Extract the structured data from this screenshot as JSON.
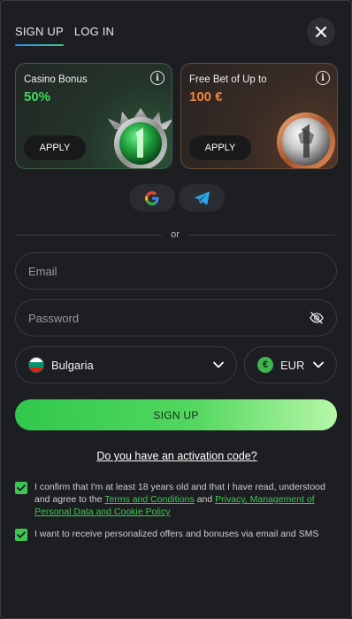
{
  "tabs": [
    {
      "label": "SIGN UP",
      "active": true
    },
    {
      "label": "LOG IN",
      "active": false
    }
  ],
  "cards": [
    {
      "title": "Casino Bonus",
      "value": "50%",
      "apply": "APPLY",
      "color": "#3fd65a"
    },
    {
      "title": "Free Bet of Up to",
      "value": "100 €",
      "apply": "APPLY",
      "color": "#f0833a"
    }
  ],
  "social": {
    "google": "google-icon",
    "telegram": "telegram-icon"
  },
  "divider": {
    "or": "or"
  },
  "form": {
    "email_placeholder": "Email",
    "password_placeholder": "Password",
    "country": "Bulgaria",
    "currency": "EUR",
    "currency_symbol": "€"
  },
  "signup_button": "SIGN UP",
  "activation_link": "Do you have an activation code?",
  "consents": {
    "age_prefix": "I confirm that I'm at least 18 years old and that I have read, understood and agree to the ",
    "terms_link": "Terms and Conditions",
    "and": " and ",
    "privacy_link": "Privacy, Management of Personal Data and Cookie Policy",
    "marketing": "I want to receive personalized offers and bonuses via email and SMS"
  },
  "colors": {
    "accent_green": "#3fc552",
    "accent_orange": "#f0833a",
    "background": "#1d1e22"
  }
}
